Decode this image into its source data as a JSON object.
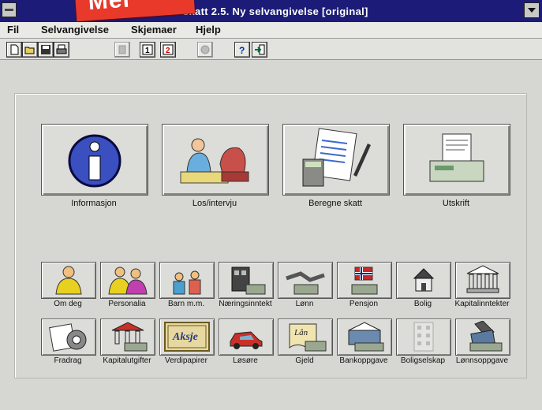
{
  "window": {
    "title": "skatt 2.5. Ny selvangivelse [original]",
    "banner_text": "Mer"
  },
  "menu": [
    "Fil",
    "Selvangivelse",
    "Skjemaer",
    "Hjelp"
  ],
  "toolbar_icons": [
    "new-file-icon",
    "open-folder-icon",
    "save-icon",
    "print-icon",
    "disabled-tool-icon",
    "form-1-icon",
    "form-2-icon",
    "disabled-gear-icon",
    "help-icon",
    "exit-icon"
  ],
  "main_buttons": [
    {
      "label": "Informasjon",
      "icon": "info-icon"
    },
    {
      "label": "Los/intervju",
      "icon": "interview-icon"
    },
    {
      "label": "Beregne skatt",
      "icon": "calculator-icon"
    },
    {
      "label": "Utskrift",
      "icon": "printer-icon"
    }
  ],
  "categories": [
    {
      "label": "Om deg",
      "icon": "person-icon"
    },
    {
      "label": "Personalia",
      "icon": "couple-icon"
    },
    {
      "label": "Barn m.m.",
      "icon": "children-icon"
    },
    {
      "label": "Næringsinntekt",
      "icon": "business-income-icon"
    },
    {
      "label": "Lønn",
      "icon": "handshake-icon"
    },
    {
      "label": "Pensjon",
      "icon": "flag-icon"
    },
    {
      "label": "Bolig",
      "icon": "house-icon"
    },
    {
      "label": "Kapitalinntekter",
      "icon": "bank-icon"
    },
    {
      "label": "Fradrag",
      "icon": "deduction-icon"
    },
    {
      "label": "Kapitalutgifter",
      "icon": "bank-expense-icon"
    },
    {
      "label": "Verdipapirer",
      "icon": "shares-icon"
    },
    {
      "label": "Løsøre",
      "icon": "car-icon"
    },
    {
      "label": "Gjeld",
      "icon": "debt-icon"
    },
    {
      "label": "Bankoppgave",
      "icon": "bank-statement-icon"
    },
    {
      "label": "Boligselskap",
      "icon": "building-icon"
    },
    {
      "label": "Lønnsoppgave",
      "icon": "salary-statement-icon"
    }
  ],
  "share_icon_text": "Aksje",
  "loan_icon_text": "Lån",
  "colors": {
    "titlebar": "#1c1c78",
    "banner": "#e8392a",
    "face": "#dcdcd8"
  }
}
